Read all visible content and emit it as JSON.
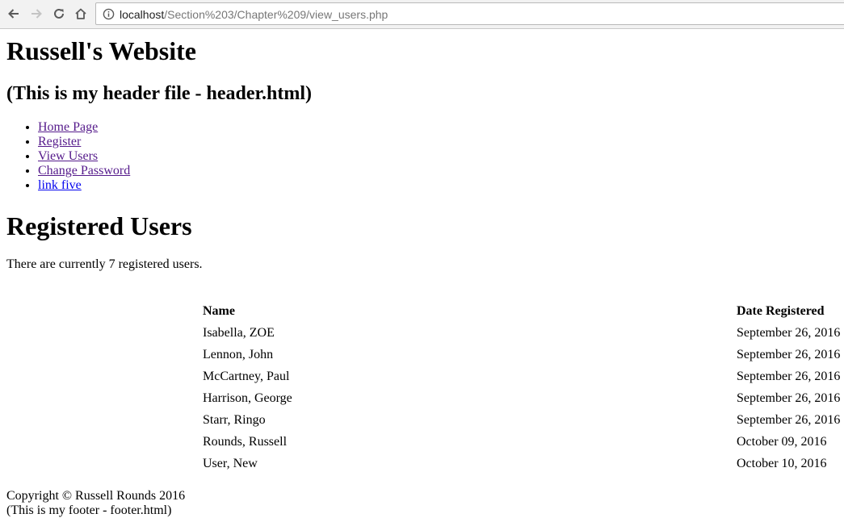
{
  "browser": {
    "url_host": "localhost",
    "url_path": "/Section%203/Chapter%209/view_users.php"
  },
  "header": {
    "site_title": "Russell's Website",
    "subtitle": "(This is my header file - header.html)"
  },
  "nav": {
    "items": [
      {
        "label": "Home Page",
        "visited": true
      },
      {
        "label": "Register",
        "visited": true
      },
      {
        "label": "View Users",
        "visited": true
      },
      {
        "label": "Change Password",
        "visited": true
      },
      {
        "label": "link five",
        "visited": false
      }
    ]
  },
  "main": {
    "heading": "Registered Users",
    "count_text": "There are currently 7 registered users.",
    "table": {
      "headers": [
        "Name",
        "Date Registered"
      ],
      "rows": [
        [
          "Isabella, ZOE",
          "September 26, 2016"
        ],
        [
          "Lennon, John",
          "September 26, 2016"
        ],
        [
          "McCartney, Paul",
          "September 26, 2016"
        ],
        [
          "Harrison, George",
          "September 26, 2016"
        ],
        [
          "Starr, Ringo",
          "September 26, 2016"
        ],
        [
          "Rounds, Russell",
          "October 09, 2016"
        ],
        [
          "User, New",
          "October 10, 2016"
        ]
      ]
    }
  },
  "footer": {
    "copyright": "Copyright © Russell Rounds 2016",
    "note": "(This is my footer - footer.html)"
  },
  "colors": {
    "visited_link": "#551a8b",
    "unvisited_link": "#0000ee",
    "toolbar_bg": "#f2f2f2"
  }
}
